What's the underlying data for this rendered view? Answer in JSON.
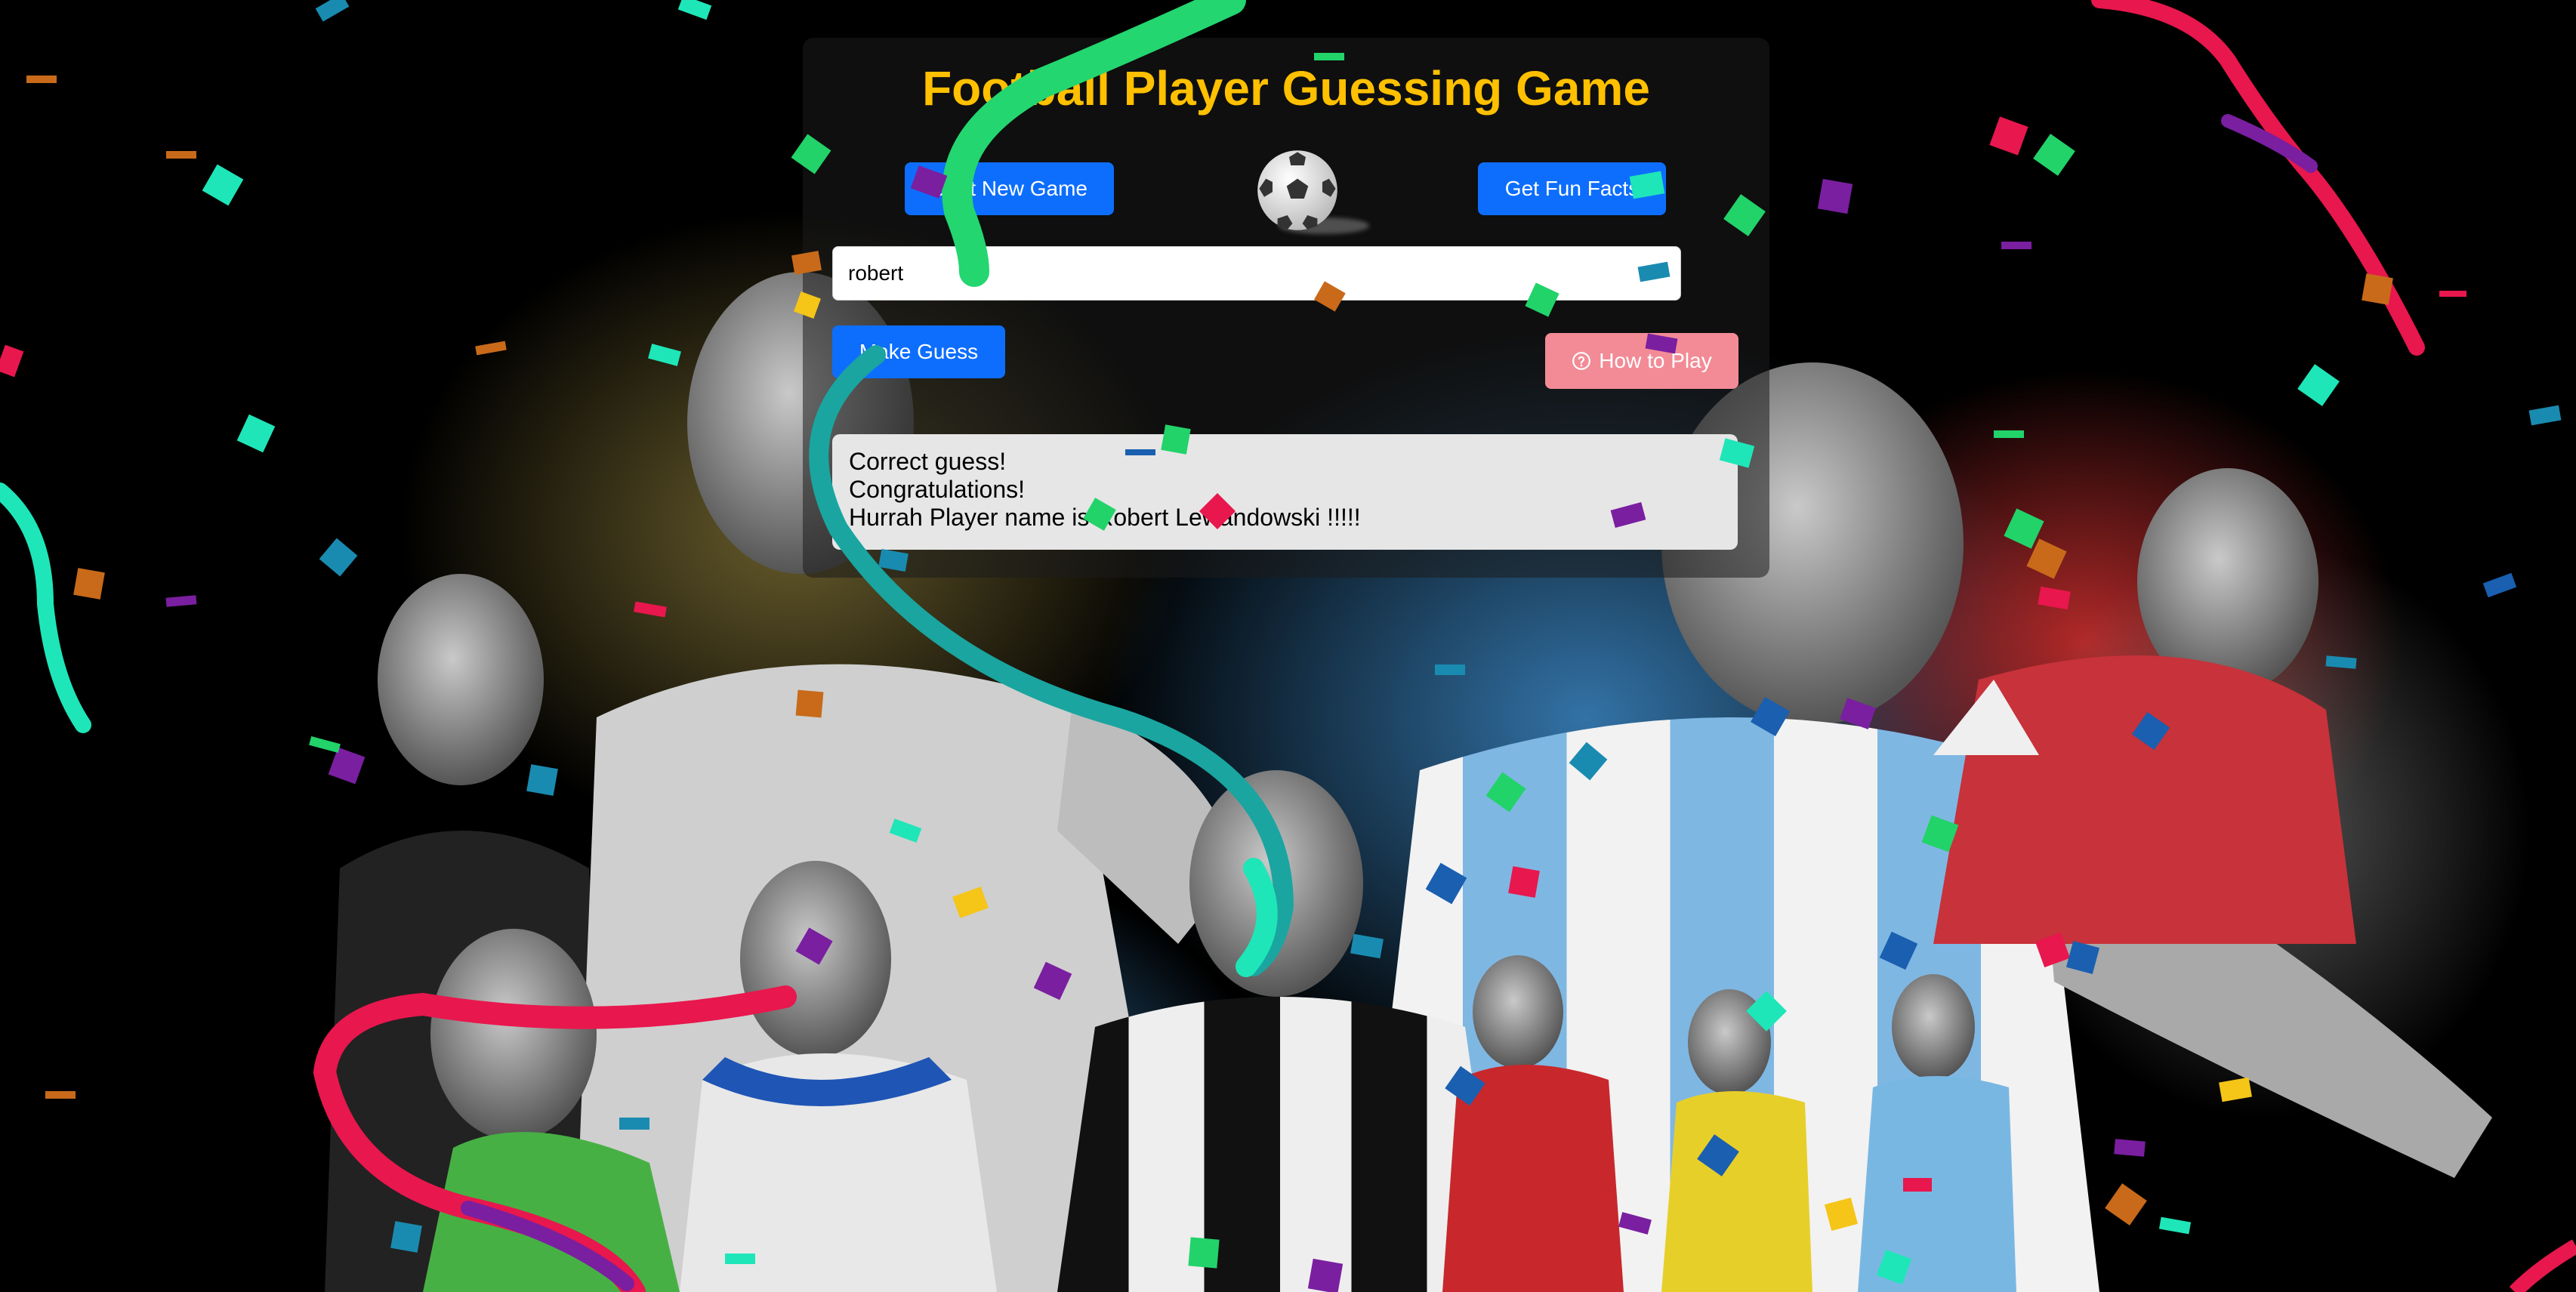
{
  "title": "Football Player Guessing Game",
  "buttons": {
    "start_new_game": "Start New Game",
    "get_fun_facts": "Get Fun Facts",
    "make_guess": "Make Guess",
    "how_to_play": "How to Play"
  },
  "guess_input": {
    "value": "robert"
  },
  "result": {
    "lines": [
      "Correct guess!",
      "Congratulations!",
      "Hurrah Player name is Robert Lewandowski !!!!!"
    ]
  },
  "icons": {
    "ball": "soccer-ball-icon",
    "help": "question-circle-icon"
  },
  "colors": {
    "title": "#ffc000",
    "primary_button": "#0d6efd",
    "help_button": "#f28b96",
    "result_background": "#e6e6e6"
  }
}
